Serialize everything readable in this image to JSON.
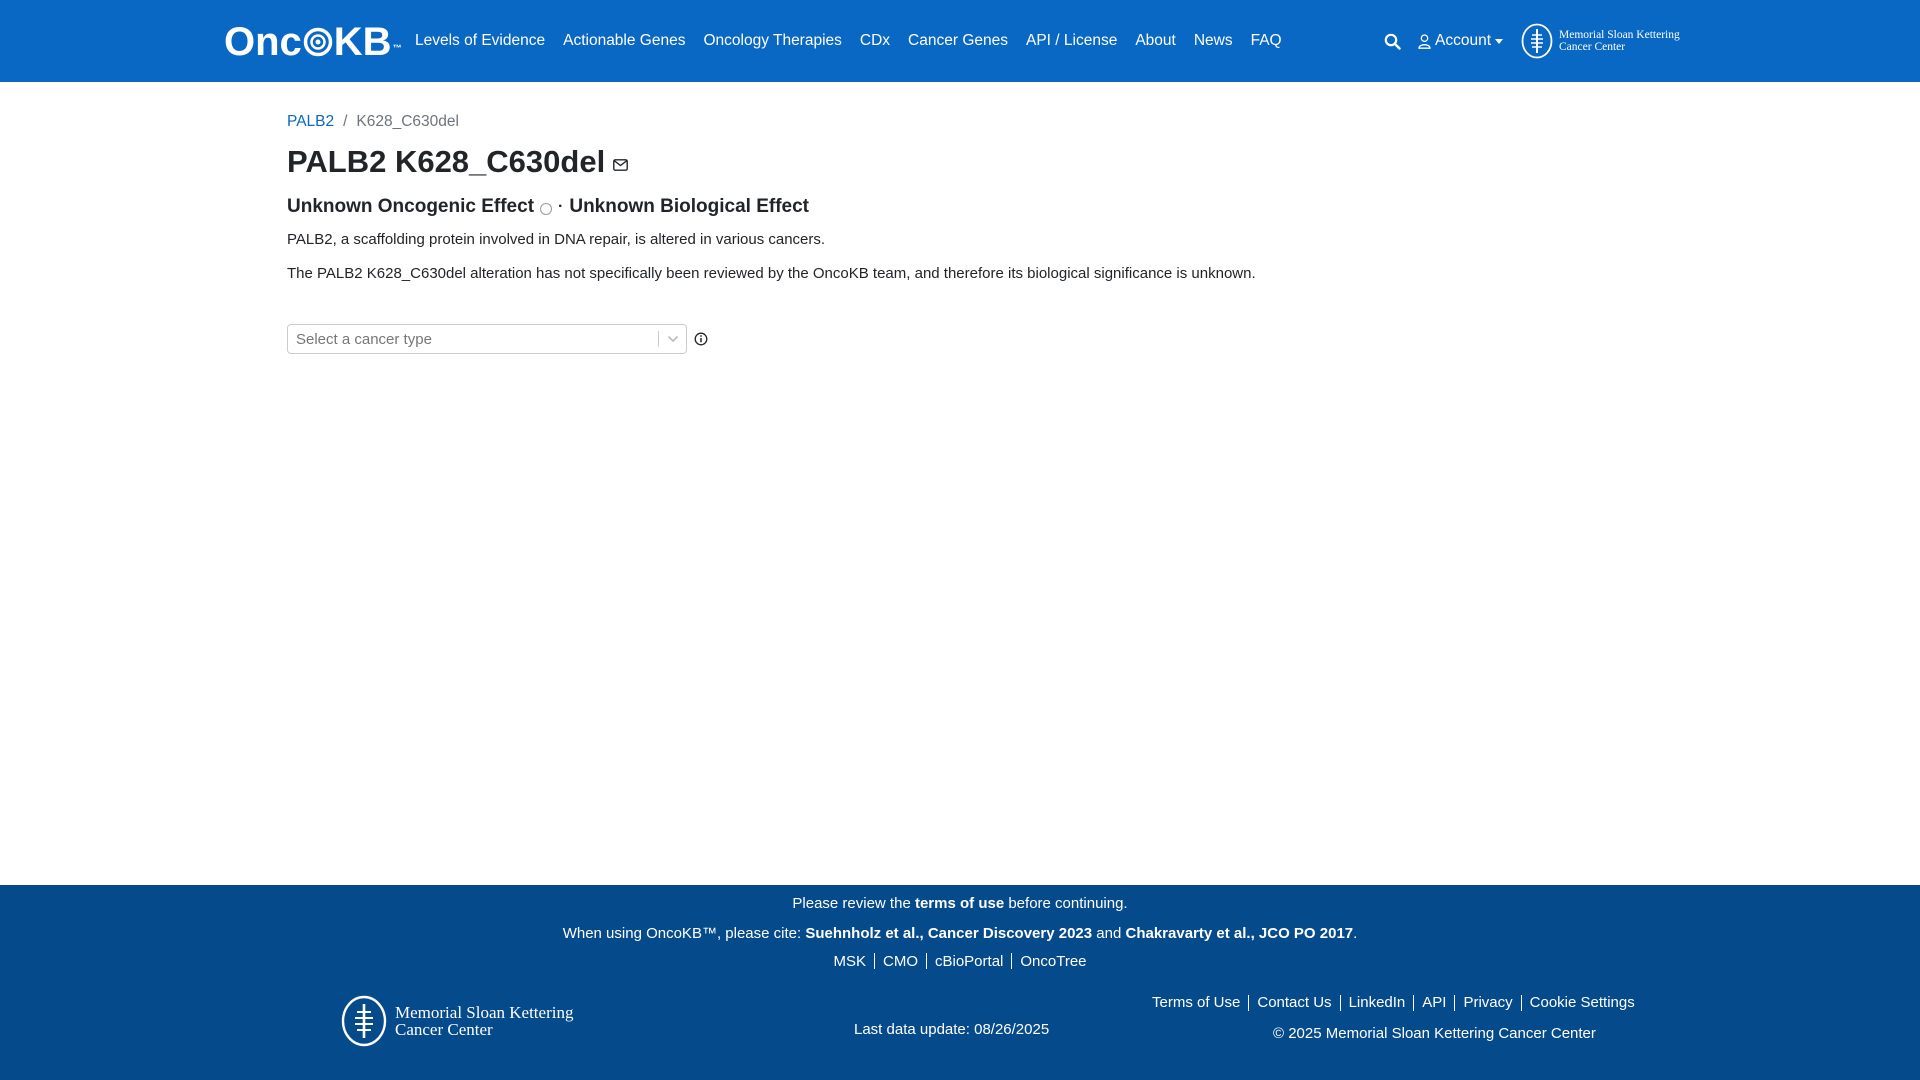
{
  "navbar": {
    "logo": {
      "part1": "Onc",
      "part2": "KB",
      "tm": "™"
    },
    "links": [
      "Levels of Evidence",
      "Actionable Genes",
      "Oncology Therapies",
      "CDx",
      "Cancer Genes",
      "API / License",
      "About",
      "News",
      "FAQ"
    ],
    "account_label": "Account",
    "msk_logo": {
      "line1": "Memorial Sloan Kettering",
      "line2": "Cancer Center"
    }
  },
  "breadcrumb": {
    "gene": "PALB2",
    "separator": "/",
    "current": "K628_C630del"
  },
  "title": "PALB2 K628_C630del",
  "effects": {
    "oncogenic": "Unknown Oncogenic Effect",
    "separator": "·",
    "biological": "Unknown Biological Effect"
  },
  "description": {
    "gene_summary": "PALB2, a scaffolding protein involved in DNA repair, is altered in various cancers.",
    "alteration_summary": "The PALB2 K628_C630del alteration has not specifically been reviewed by the OncoKB team, and therefore its biological significance is unknown."
  },
  "cancer_select": {
    "placeholder": "Select a cancer type"
  },
  "footer": {
    "terms_pre": "Please review the ",
    "terms_link": "terms of use",
    "terms_post": " before continuing.",
    "cite_pre": "When using OncoKB™, please cite: ",
    "cite_1": "Suehnholz et al., Cancer Discovery 2023",
    "cite_and": " and ",
    "cite_2": "Chakravarty et al., JCO PO 2017",
    "cite_post": ".",
    "partner_links": [
      "MSK",
      "CMO",
      "cBioPortal",
      "OncoTree"
    ],
    "msk_logo": {
      "line1": "Memorial Sloan Kettering",
      "line2": "Cancer Center"
    },
    "last_update": "Last data update: 08/26/2025",
    "links": [
      "Terms of Use",
      "Contact Us",
      "LinkedIn",
      "API",
      "Privacy",
      "Cookie Settings"
    ],
    "copyright": "© 2025 Memorial Sloan Kettering Cancer Center"
  },
  "colors": {
    "navbar": "#0968c3",
    "footer": "#054a8b",
    "link": "#0968c3"
  }
}
